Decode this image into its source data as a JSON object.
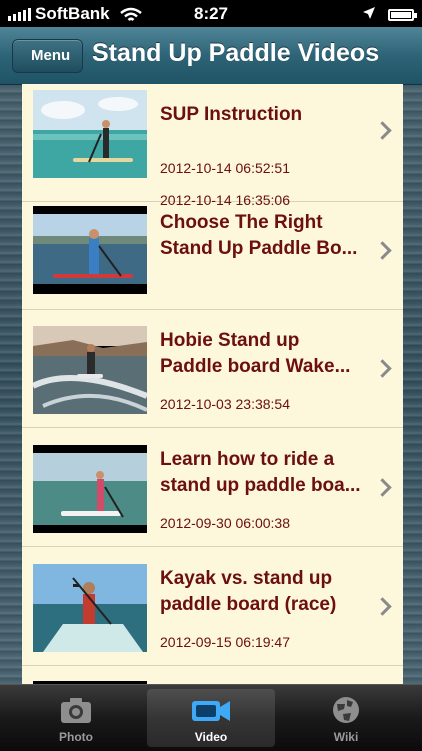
{
  "status_bar": {
    "carrier": "SoftBank",
    "time": "8:27"
  },
  "nav": {
    "back_label": "Menu",
    "title": "Stand Up Paddle Videos"
  },
  "videos": [
    {
      "title": "SUP Instruction",
      "date": "2012-10-14 06:52:51"
    },
    {
      "title": "Choose The Right\nStand Up Paddle Bo...",
      "date": "2012-10-14 16:35:06"
    },
    {
      "title": "Hobie Stand up\nPaddle board Wake...",
      "date": "2012-10-03 23:38:54"
    },
    {
      "title": "Learn how to ride a\nstand up paddle boa...",
      "date": "2012-09-30 06:00:38"
    },
    {
      "title": "Kayak vs. stand up\npaddle board (race)",
      "date": "2012-09-15 06:19:47"
    }
  ],
  "tabs": [
    {
      "label": "Photo",
      "icon": "camera-icon"
    },
    {
      "label": "Video",
      "icon": "video-camera-icon"
    },
    {
      "label": "Wiki",
      "icon": "wiki-globe-icon"
    }
  ],
  "colors": {
    "title_text": "#6b0f0f",
    "list_background": "#fdf7dc",
    "navbar": "#2e6477",
    "active_tab_icon": "#3fa9f5"
  }
}
